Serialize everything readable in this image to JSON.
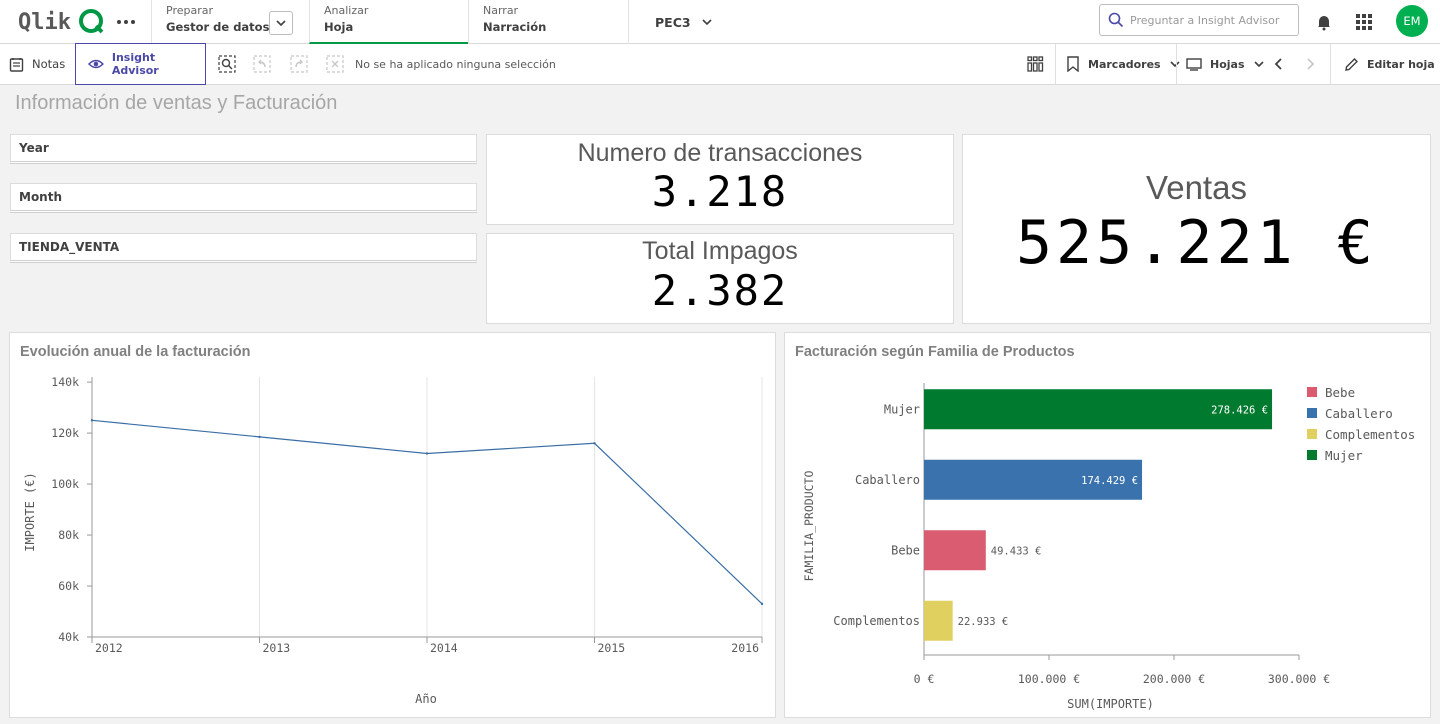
{
  "topnav": {
    "logo_text": "Qlik",
    "prepare": {
      "small": "Preparar",
      "big": "Gestor de datos"
    },
    "analyze": {
      "small": "Analizar",
      "big": "Hoja"
    },
    "narrate": {
      "small": "Narrar",
      "big": "Narración"
    },
    "app_name": "PEC3",
    "search_placeholder": "Preguntar a Insight Advisor",
    "avatar": "EM"
  },
  "toolbar": {
    "notes": "Notas",
    "insight_advisor": "Insight Advisor",
    "no_selection": "No se ha aplicado ninguna selección",
    "bookmarks": "Marcadores",
    "sheets": "Hojas",
    "edit_sheet": "Editar hoja"
  },
  "sheet": {
    "title": "Información de ventas y Facturación",
    "filters": [
      "Year",
      "Month",
      "TIENDA_VENTA"
    ],
    "kpi_transactions": {
      "label": "Numero de transacciones",
      "value": "3.218"
    },
    "kpi_unpaid": {
      "label": "Total Impagos",
      "value": "2.382"
    },
    "kpi_sales": {
      "label": "Ventas",
      "value": "525.221 €"
    }
  },
  "chart_data": [
    {
      "type": "line",
      "title": "Evolución anual de la facturación",
      "xlabel": "Año",
      "ylabel": "IMPORTE (€)",
      "x": [
        "2012",
        "2013",
        "2014",
        "2015",
        "2016"
      ],
      "series": [
        {
          "values": [
            125000,
            118500,
            112000,
            116000,
            53000
          ]
        }
      ],
      "ylim": [
        40000,
        142000
      ],
      "yticks": [
        40000,
        60000,
        80000,
        100000,
        120000,
        140000
      ],
      "ytick_labels": [
        "40k",
        "60k",
        "80k",
        "100k",
        "120k",
        "140k"
      ],
      "grid": "vertical",
      "color": "#3a6ea5"
    },
    {
      "type": "bar",
      "orientation": "horizontal",
      "title": "Facturación según Familia de Productos",
      "xlabel": "SUM(IMPORTE)",
      "ylabel": "FAMILIA_PRODUCTO",
      "categories": [
        "Mujer",
        "Caballero",
        "Bebe",
        "Complementos"
      ],
      "values": [
        278426,
        174429,
        49433,
        22933
      ],
      "data_labels": [
        "278.426 €",
        "174.429 €",
        "49.433 €",
        "22.933 €"
      ],
      "colors": [
        "#007a2e",
        "#3a72ad",
        "#d95c70",
        "#e0d060"
      ],
      "xlim": [
        0,
        300000
      ],
      "xticks": [
        0,
        100000,
        200000,
        300000
      ],
      "xtick_labels": [
        "0 €",
        "100.000 €",
        "200.000 €",
        "300.000 €"
      ],
      "legend": [
        {
          "name": "Bebe",
          "color": "#d95c70"
        },
        {
          "name": "Caballero",
          "color": "#3a72ad"
        },
        {
          "name": "Complementos",
          "color": "#e0d060"
        },
        {
          "name": "Mujer",
          "color": "#007a2e"
        }
      ],
      "legend_position": "right"
    }
  ]
}
